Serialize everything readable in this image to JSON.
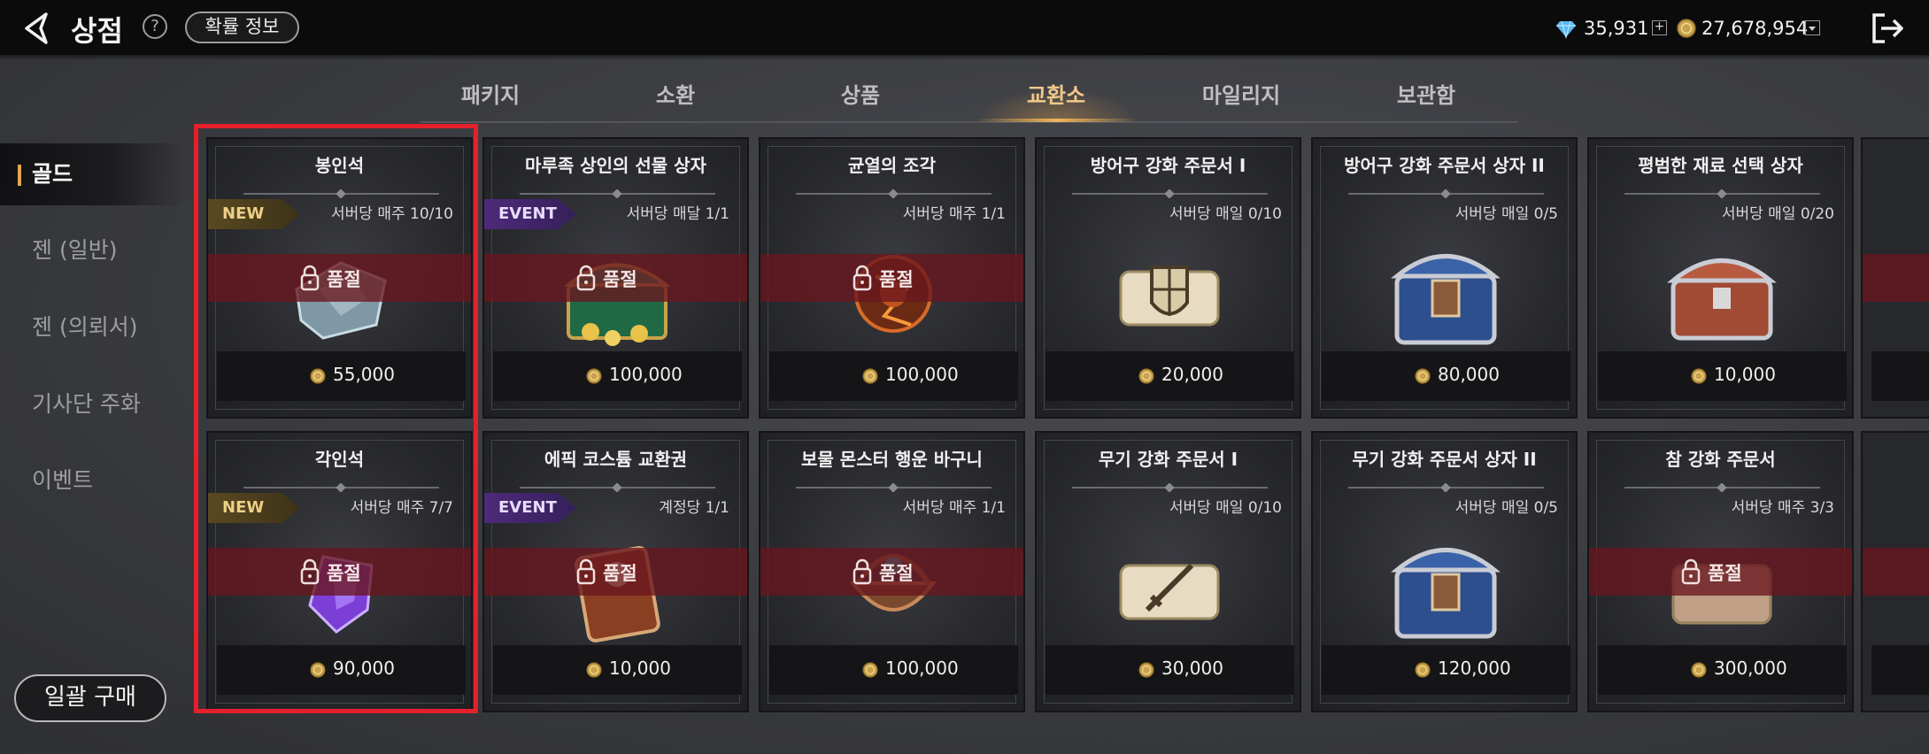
{
  "header": {
    "title": "상점",
    "help_label": "?",
    "probability_button": "확률 정보",
    "diamond_amount": "35,931",
    "gold_amount": "27,678,954",
    "plus_label": "+"
  },
  "tabs": [
    {
      "label": "패키지"
    },
    {
      "label": "소환"
    },
    {
      "label": "상품"
    },
    {
      "label": "교환소",
      "active": true
    },
    {
      "label": "마일리지"
    },
    {
      "label": "보관함"
    }
  ],
  "sidebar": {
    "items": [
      {
        "label": "골드",
        "active": true
      },
      {
        "label": "젠 (일반)"
      },
      {
        "label": "젠 (의뢰서)"
      },
      {
        "label": "기사단 주화"
      },
      {
        "label": "이벤트"
      }
    ],
    "bulk_buy": "일괄 구매"
  },
  "soldout_label": "품절",
  "items": [
    {
      "name": "봉인석",
      "limit": "서버당 매주 10/10",
      "badge": "NEW",
      "soldout": true,
      "price": "55,000",
      "icon": "seal-stone-icon"
    },
    {
      "name": "마루족 상인의 선물 상자",
      "limit": "서버당 매달 1/1",
      "badge": "EVENT",
      "soldout": true,
      "price": "100,000",
      "icon": "gift-chest-icon"
    },
    {
      "name": "균열의 조각",
      "limit": "서버당 매주 1/1",
      "badge": "",
      "soldout": true,
      "price": "100,000",
      "icon": "rift-fragment-icon"
    },
    {
      "name": "방어구 강화 주문서 I",
      "limit": "서버당 매일 0/10",
      "badge": "",
      "soldout": false,
      "price": "20,000",
      "icon": "armor-scroll-icon"
    },
    {
      "name": "방어구 강화 주문서 상자 II",
      "limit": "서버당 매일 0/5",
      "badge": "",
      "soldout": false,
      "price": "80,000",
      "icon": "armor-scroll-box-icon"
    },
    {
      "name": "평범한 재료 선택 상자",
      "limit": "서버당 매일 0/20",
      "badge": "",
      "soldout": false,
      "price": "10,000",
      "icon": "material-chest-icon"
    },
    {
      "name": "각인석",
      "limit": "서버당 매주 7/7",
      "badge": "NEW",
      "soldout": true,
      "price": "90,000",
      "icon": "engrave-stone-icon"
    },
    {
      "name": "에픽 코스튬 교환권",
      "limit": "계정당 1/1",
      "badge": "EVENT",
      "soldout": true,
      "price": "10,000",
      "icon": "costume-ticket-icon"
    },
    {
      "name": "보물 몬스터 행운 바구니",
      "limit": "서버당 매주 1/1",
      "badge": "",
      "soldout": true,
      "price": "100,000",
      "icon": "treasure-basket-icon"
    },
    {
      "name": "무기 강화 주문서 I",
      "limit": "서버당 매일 0/10",
      "badge": "",
      "soldout": false,
      "price": "30,000",
      "icon": "weapon-scroll-icon"
    },
    {
      "name": "무기 강화 주문서 상자 II",
      "limit": "서버당 매일 0/5",
      "badge": "",
      "soldout": false,
      "price": "120,000",
      "icon": "weapon-scroll-box-icon"
    },
    {
      "name": "참 강화 주문서",
      "limit": "서버당 매주 3/3",
      "badge": "",
      "soldout": true,
      "price": "300,000",
      "icon": "charm-scroll-icon"
    }
  ],
  "colors": {
    "accent_tab": "#f1c98a",
    "soldout_strip": "#69161e",
    "selection_frame": "#e4202b",
    "new_badge": "#5a4a22",
    "event_badge": "#4d2a79"
  }
}
